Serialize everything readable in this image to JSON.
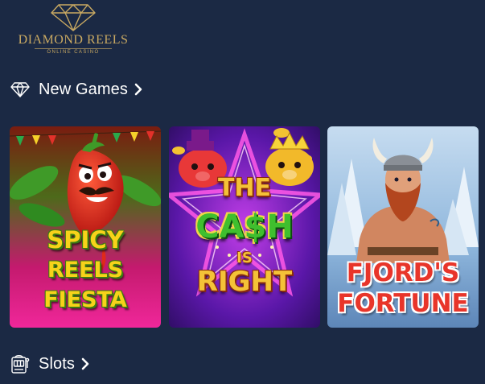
{
  "brand": {
    "title": "DIAMOND REELS",
    "subtitle": "ONLINE CASINO",
    "accent_color": "#c9a962",
    "icon": "diamond-icon"
  },
  "sections": {
    "new_games": {
      "label": "New Games",
      "icon": "diamond-outline-icon",
      "chevron": "chevron-right-icon"
    },
    "slots": {
      "label": "Slots",
      "icon": "slot-machine-icon",
      "chevron": "chevron-right-icon"
    }
  },
  "games": [
    {
      "line1": "SPICY",
      "line2": "REELS",
      "line3": "FIESTA",
      "theme_color": "#e0188a"
    },
    {
      "line1": "THE",
      "line2": "CA$H",
      "line3": "IS",
      "line4": "RIGHT",
      "theme_color": "#7a1fd0"
    },
    {
      "line1": "FJORD'S",
      "line2": "FORTUNE",
      "theme_color": "#9ec7e8"
    }
  ],
  "colors": {
    "background": "#1b2944",
    "text": "#ffffff"
  }
}
